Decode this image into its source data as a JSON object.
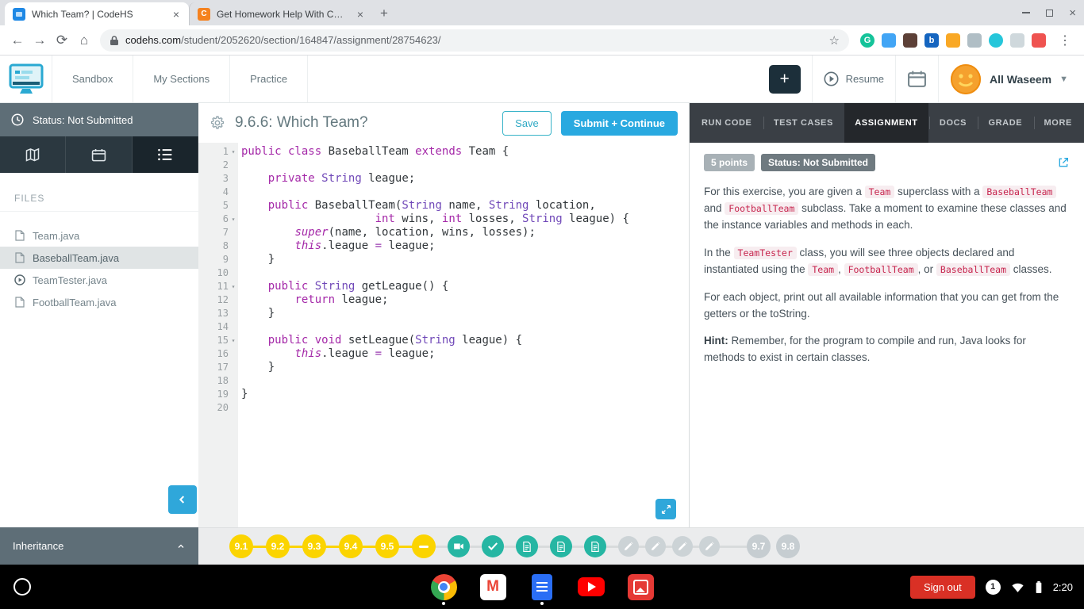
{
  "browser": {
    "tabs": [
      {
        "title": "Which Team? | CodeHS"
      },
      {
        "title": "Get Homework Help With Chegg"
      }
    ],
    "url_host": "codehs.com",
    "url_path": "/student/2052620/section/164847/assignment/28754623/",
    "extensions": [
      {
        "name": "grammarly-extension-icon",
        "color": "#15c39a",
        "shape": "circle",
        "glyph": "G"
      },
      {
        "name": "extension-icon-blue",
        "color": "#42a5f5",
        "shape": "square",
        "glyph": ""
      },
      {
        "name": "extension-icon-dark",
        "color": "#5d4037",
        "shape": "square",
        "glyph": ""
      },
      {
        "name": "extension-icon-b",
        "color": "#1565c0",
        "shape": "square",
        "glyph": "b"
      },
      {
        "name": "extension-icon-yellow",
        "color": "#f9a825",
        "shape": "square",
        "glyph": ""
      },
      {
        "name": "extension-icon-gray",
        "color": "#b0bec5",
        "shape": "square",
        "glyph": ""
      },
      {
        "name": "extension-icon-teal",
        "color": "#26c6da",
        "shape": "circle",
        "glyph": ""
      },
      {
        "name": "extension-icon-light",
        "color": "#cfd8dc",
        "shape": "square",
        "glyph": ""
      },
      {
        "name": "extension-icon-colorful",
        "color": "#ef5350",
        "shape": "square",
        "glyph": ""
      }
    ]
  },
  "header": {
    "nav": [
      {
        "label": "Sandbox"
      },
      {
        "label": "My Sections"
      },
      {
        "label": "Practice"
      }
    ],
    "add_button": "+",
    "resume_label": "Resume",
    "user_name": "All Waseem"
  },
  "sidebar": {
    "status_text": "Status: Not Submitted",
    "files_heading": "FILES",
    "files": [
      {
        "name": "Team.java",
        "icon": "file",
        "selected": false
      },
      {
        "name": "BaseballTeam.java",
        "icon": "file",
        "selected": true
      },
      {
        "name": "TeamTester.java",
        "icon": "play",
        "selected": false
      },
      {
        "name": "FootballTeam.java",
        "icon": "file",
        "selected": false
      }
    ],
    "footer_label": "Inheritance"
  },
  "editor": {
    "title": "9.6.6: Which Team?",
    "save_button": "Save",
    "submit_button": "Submit + Continue",
    "lines": [
      {
        "n": 1,
        "fold": true,
        "tokens": [
          [
            "kw",
            "public class"
          ],
          [
            "pl",
            " BaseballTeam "
          ],
          [
            "kw",
            "extends"
          ],
          [
            "pl",
            " Team {"
          ]
        ]
      },
      {
        "n": 2,
        "fold": false,
        "tokens": []
      },
      {
        "n": 3,
        "fold": false,
        "tokens": [
          [
            "pl",
            "    "
          ],
          [
            "kw",
            "private"
          ],
          [
            "pl",
            " "
          ],
          [
            "ty",
            "String"
          ],
          [
            "pl",
            " league;"
          ]
        ]
      },
      {
        "n": 4,
        "fold": false,
        "tokens": []
      },
      {
        "n": 5,
        "fold": false,
        "tokens": [
          [
            "pl",
            "    "
          ],
          [
            "kw",
            "public"
          ],
          [
            "pl",
            " BaseballTeam("
          ],
          [
            "ty",
            "String"
          ],
          [
            "pl",
            " name, "
          ],
          [
            "ty",
            "String"
          ],
          [
            "pl",
            " location,"
          ]
        ]
      },
      {
        "n": 6,
        "fold": true,
        "tokens": [
          [
            "pl",
            "                    "
          ],
          [
            "kw",
            "int"
          ],
          [
            "pl",
            " wins, "
          ],
          [
            "kw",
            "int"
          ],
          [
            "pl",
            " losses, "
          ],
          [
            "ty",
            "String"
          ],
          [
            "pl",
            " league) {"
          ]
        ]
      },
      {
        "n": 7,
        "fold": false,
        "tokens": [
          [
            "pl",
            "        "
          ],
          [
            "kw2",
            "super"
          ],
          [
            "pl",
            "(name, location, wins, losses);"
          ]
        ]
      },
      {
        "n": 8,
        "fold": false,
        "tokens": [
          [
            "pl",
            "        "
          ],
          [
            "kw2",
            "this"
          ],
          [
            "pl",
            ".league "
          ],
          [
            "op",
            "="
          ],
          [
            "pl",
            " league;"
          ]
        ]
      },
      {
        "n": 9,
        "fold": false,
        "tokens": [
          [
            "pl",
            "    }"
          ]
        ]
      },
      {
        "n": 10,
        "fold": false,
        "tokens": []
      },
      {
        "n": 11,
        "fold": true,
        "tokens": [
          [
            "pl",
            "    "
          ],
          [
            "kw",
            "public"
          ],
          [
            "pl",
            " "
          ],
          [
            "ty",
            "String"
          ],
          [
            "pl",
            " getLeague() {"
          ]
        ]
      },
      {
        "n": 12,
        "fold": false,
        "tokens": [
          [
            "pl",
            "        "
          ],
          [
            "kw",
            "return"
          ],
          [
            "pl",
            " league;"
          ]
        ]
      },
      {
        "n": 13,
        "fold": false,
        "tokens": [
          [
            "pl",
            "    }"
          ]
        ]
      },
      {
        "n": 14,
        "fold": false,
        "tokens": []
      },
      {
        "n": 15,
        "fold": true,
        "tokens": [
          [
            "pl",
            "    "
          ],
          [
            "kw",
            "public void"
          ],
          [
            "pl",
            " setLeague("
          ],
          [
            "ty",
            "String"
          ],
          [
            "pl",
            " league) {"
          ]
        ]
      },
      {
        "n": 16,
        "fold": false,
        "tokens": [
          [
            "pl",
            "        "
          ],
          [
            "kw2",
            "this"
          ],
          [
            "pl",
            ".league "
          ],
          [
            "op",
            "="
          ],
          [
            "pl",
            " league;"
          ]
        ]
      },
      {
        "n": 17,
        "fold": false,
        "tokens": [
          [
            "pl",
            "    }"
          ]
        ]
      },
      {
        "n": 18,
        "fold": false,
        "tokens": []
      },
      {
        "n": 19,
        "fold": false,
        "tokens": [
          [
            "pl",
            "}"
          ]
        ]
      },
      {
        "n": 20,
        "fold": false,
        "tokens": []
      }
    ]
  },
  "panel": {
    "tabs": [
      {
        "label": "RUN CODE",
        "active": false
      },
      {
        "label": "TEST CASES",
        "active": false
      },
      {
        "label": "ASSIGNMENT",
        "active": true
      },
      {
        "label": "DOCS",
        "active": false
      },
      {
        "label": "GRADE",
        "active": false
      },
      {
        "label": "MORE",
        "active": false
      }
    ],
    "points_badge": "5 points",
    "status_badge": "Status: Not Submitted",
    "paragraphs": [
      {
        "segments": [
          {
            "text": "For this exercise, you are given a "
          },
          {
            "code": "Team"
          },
          {
            "text": " superclass with a "
          },
          {
            "code": "BaseballTeam"
          },
          {
            "text": " and "
          },
          {
            "code": "FootballTeam"
          },
          {
            "text": " subclass. Take a moment to examine these classes and the instance variables and methods in each."
          }
        ]
      },
      {
        "segments": [
          {
            "text": "In the "
          },
          {
            "code": "TeamTester"
          },
          {
            "text": " class, you will see three objects declared and instantiated using the "
          },
          {
            "code": "Team"
          },
          {
            "text": ", "
          },
          {
            "code": "FootballTeam"
          },
          {
            "text": ", or "
          },
          {
            "code": "BaseballTeam"
          },
          {
            "text": " classes."
          }
        ]
      },
      {
        "segments": [
          {
            "text": "For each object, print out all available information that you can get from the getters or the toString."
          }
        ]
      },
      {
        "segments": [
          {
            "bold": "Hint:"
          },
          {
            "text": " Remember, for the program to compile and run, Java looks for methods to exist in certain classes."
          }
        ]
      }
    ]
  },
  "progress": {
    "items": [
      {
        "label": "9.1",
        "type": "complete",
        "icon": ""
      },
      {
        "label": "9.2",
        "type": "complete",
        "icon": ""
      },
      {
        "label": "9.3",
        "type": "complete",
        "icon": ""
      },
      {
        "label": "9.4",
        "type": "complete",
        "icon": ""
      },
      {
        "label": "9.5",
        "type": "complete",
        "icon": ""
      },
      {
        "label": "",
        "type": "current",
        "icon": "dash"
      },
      {
        "label": "",
        "type": "resource",
        "icon": "video"
      },
      {
        "label": "",
        "type": "resource",
        "icon": "check"
      },
      {
        "label": "",
        "type": "resource",
        "icon": "doc"
      },
      {
        "label": "",
        "type": "resource",
        "icon": "doc"
      },
      {
        "label": "",
        "type": "resource",
        "icon": "doc"
      },
      {
        "label": "",
        "type": "locked",
        "icon": "pencil"
      },
      {
        "label": "",
        "type": "locked",
        "icon": "pencil"
      },
      {
        "label": "",
        "type": "locked",
        "icon": "pencil"
      },
      {
        "label": "",
        "type": "locked",
        "icon": "pencil"
      },
      {
        "label": "9.7",
        "type": "upcoming",
        "icon": ""
      },
      {
        "label": "9.8",
        "type": "upcoming",
        "icon": ""
      }
    ]
  },
  "shelf": {
    "sign_out_label": "Sign out",
    "notification_count": "1",
    "time": "2:20",
    "apps": [
      {
        "name": "chrome",
        "running": true
      },
      {
        "name": "gmail",
        "running": false
      },
      {
        "name": "docs",
        "running": true
      },
      {
        "name": "youtube",
        "running": false
      },
      {
        "name": "gallery",
        "running": false
      }
    ]
  },
  "colors": {
    "codehs_blue": "#29a9e0",
    "codehs_teal": "#2fa7da",
    "progress_yellow": "#fbd400",
    "progress_teal": "#26b6a3",
    "sign_out_red": "#d93025"
  }
}
